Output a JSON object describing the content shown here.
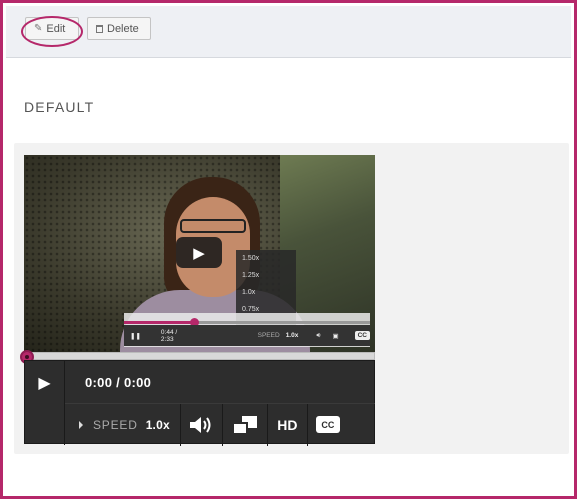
{
  "toolbar": {
    "edit_label": "Edit",
    "delete_label": "Delete"
  },
  "section": {
    "title": "DEFAULT"
  },
  "video_thumbnail": {
    "speed_options": [
      "1.50x",
      "1.25x",
      "1.0x",
      "0.75x"
    ],
    "time": "0:44 / 2:33",
    "speed_label": "SPEED",
    "speed_value": "1.0x",
    "cc_label": "CC"
  },
  "player": {
    "time": "0:00 / 0:00",
    "speed_label": "SPEED",
    "speed_value": "1.0x",
    "hd_label": "HD",
    "cc_label": "CC",
    "progress_fraction": 0.0
  },
  "colors": {
    "accent": "#b5286a",
    "controls_bg": "#2d2d2d",
    "toolbar_bg": "#eef0f4",
    "panel_bg": "#f2f2f2"
  },
  "icons": {
    "edit": "pencil-icon",
    "delete": "trash-icon",
    "play": "play-icon",
    "volume": "volume-icon",
    "fullscreen": "fullscreen-icon",
    "speed_caret": "caret-right-icon"
  }
}
